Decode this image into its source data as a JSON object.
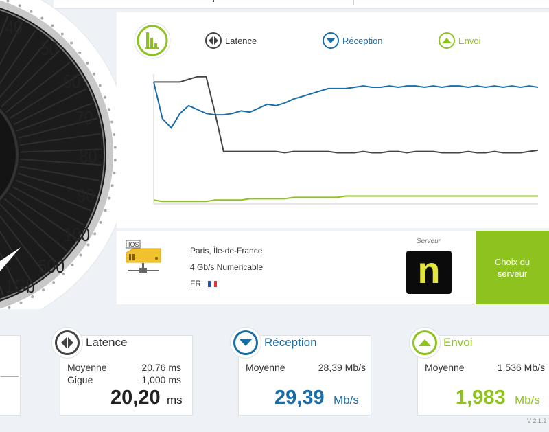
{
  "gauge": {
    "labels": [
      "40",
      "50",
      "60",
      "70",
      "80",
      "90",
      "100",
      "500",
      "1Gb"
    ]
  },
  "chart": {
    "legend": {
      "latency": {
        "label": "Latence",
        "color": "#444444"
      },
      "download": {
        "label": "Réception",
        "color": "#1a6ea8"
      },
      "upload": {
        "label": "Envoi",
        "color": "#8dc21f"
      }
    },
    "icon_name": "bar-chart-icon",
    "chart_data": {
      "type": "line",
      "series": [
        {
          "name": "Réception",
          "values": [
            0.07,
            0.35,
            0.42,
            0.31,
            0.25,
            0.28,
            0.31,
            0.32,
            0.32,
            0.31,
            0.29,
            0.3,
            0.27,
            0.24,
            0.25,
            0.23,
            0.2,
            0.18,
            0.16,
            0.14,
            0.12,
            0.12,
            0.12,
            0.11,
            0.1,
            0.11,
            0.11,
            0.1,
            0.11,
            0.1,
            0.1,
            0.11,
            0.1,
            0.11,
            0.1,
            0.1,
            0.11,
            0.1,
            0.11,
            0.1,
            0.11,
            0.1,
            0.11,
            0.1,
            0.11
          ]
        },
        {
          "name": "Latence",
          "values": [
            0.07,
            0.07,
            0.07,
            0.07,
            0.05,
            0.03,
            0.03,
            0.3,
            0.6,
            0.6,
            0.6,
            0.6,
            0.6,
            0.6,
            0.6,
            0.61,
            0.6,
            0.6,
            0.6,
            0.6,
            0.6,
            0.61,
            0.61,
            0.61,
            0.6,
            0.61,
            0.61,
            0.6,
            0.6,
            0.61,
            0.6,
            0.6,
            0.6,
            0.61,
            0.61,
            0.61,
            0.6,
            0.61,
            0.61,
            0.6,
            0.61,
            0.61,
            0.61,
            0.6,
            0.59
          ]
        },
        {
          "name": "Envoi",
          "values": [
            0.97,
            0.98,
            0.98,
            0.98,
            0.98,
            0.98,
            0.98,
            0.97,
            0.97,
            0.97,
            0.97,
            0.96,
            0.96,
            0.96,
            0.96,
            0.96,
            0.95,
            0.95,
            0.95,
            0.95,
            0.95,
            0.95,
            0.94,
            0.94,
            0.94,
            0.94,
            0.94,
            0.94,
            0.94,
            0.94,
            0.94,
            0.94,
            0.94,
            0.94,
            0.94,
            0.94,
            0.94,
            0.94,
            0.94,
            0.94,
            0.94,
            0.94,
            0.94,
            0.94,
            0.94
          ]
        }
      ],
      "grid": false
    }
  },
  "server": {
    "section_label": "Serveur",
    "location": "Paris, Île-de-France",
    "isp": "4 Gb/s Numericable",
    "country": "FR",
    "isp_badge": "IOS",
    "logo_letter": "n",
    "choose_label_1": "Choix du",
    "choose_label_2": "serveur"
  },
  "stats": {
    "latency": {
      "title": "Latence",
      "avg_label": "Moyenne",
      "avg_value": "20,76 ms",
      "jitter_label": "Gigue",
      "jitter_value": "1,000 ms",
      "big_value": "20,20",
      "big_unit": "ms"
    },
    "download": {
      "title": "Réception",
      "avg_label": "Moyenne",
      "avg_value": "28,39 Mb/s",
      "big_value": "29,39",
      "big_unit": "Mb/s"
    },
    "upload": {
      "title": "Envoi",
      "avg_label": "Moyenne",
      "avg_value": "1,536 Mb/s",
      "big_value": "1,983",
      "big_unit": "Mb/s"
    }
  },
  "version": "V 2.1.2"
}
